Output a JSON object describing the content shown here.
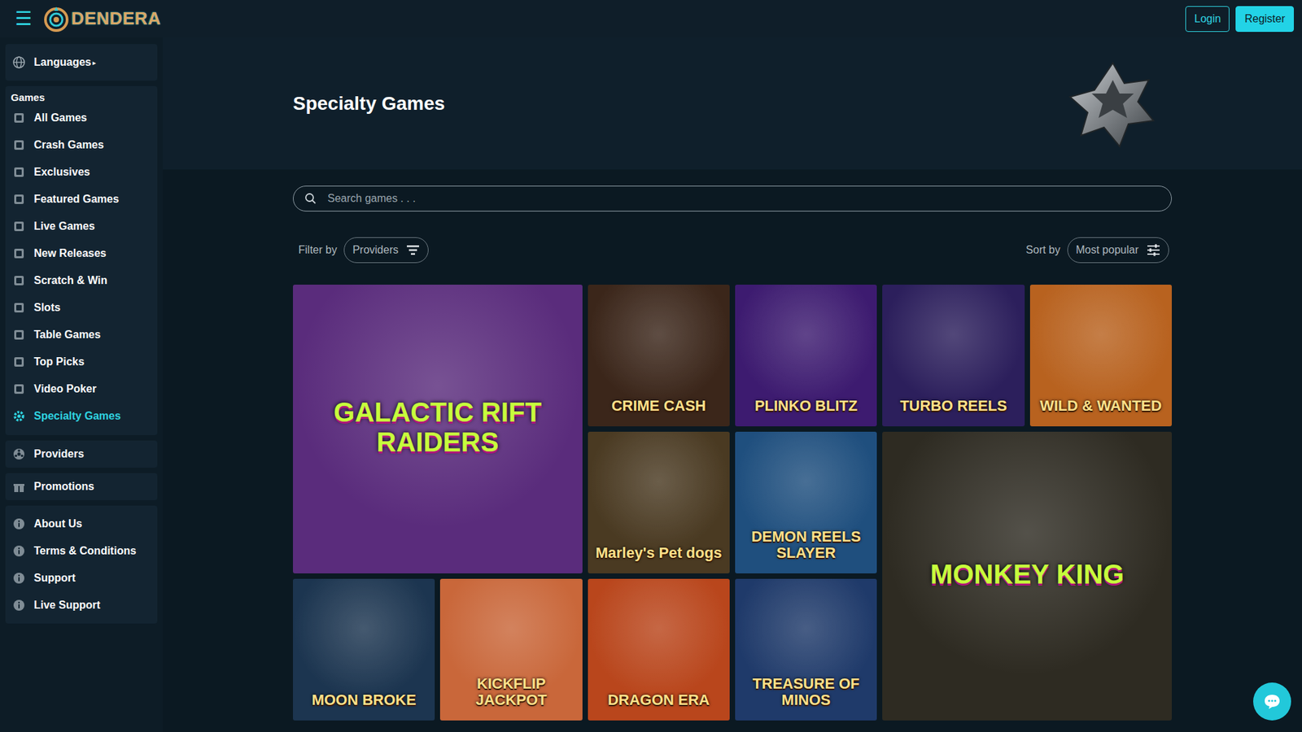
{
  "header": {
    "menu_icon": "☰",
    "logo": "DENDERA",
    "login": "Login",
    "register": "Register"
  },
  "sidebar": {
    "languages": {
      "label": "Languages",
      "caret": "▸"
    },
    "games_heading": "Games",
    "games": [
      {
        "label": "All Games",
        "selected": false
      },
      {
        "label": "Crash Games",
        "selected": false
      },
      {
        "label": "Exclusives",
        "selected": false
      },
      {
        "label": "Featured Games",
        "selected": false
      },
      {
        "label": "Live Games",
        "selected": false
      },
      {
        "label": "New Releases",
        "selected": false
      },
      {
        "label": "Scratch & Win",
        "selected": false
      },
      {
        "label": "Slots",
        "selected": false
      },
      {
        "label": "Table Games",
        "selected": false
      },
      {
        "label": "Top Picks",
        "selected": false
      },
      {
        "label": "Video Poker",
        "selected": false
      },
      {
        "label": "Specialty Games",
        "selected": true
      }
    ],
    "providers": "Providers",
    "promotions": "Promotions",
    "info": [
      "About Us",
      "Terms & Conditions",
      "Support",
      "Live Support"
    ]
  },
  "page": {
    "title": "Specialty Games"
  },
  "search": {
    "placeholder": "Search games . . ."
  },
  "filter": {
    "label": "Filter by",
    "value": "Providers"
  },
  "sort": {
    "label": "Sort by",
    "value": "Most popular"
  },
  "games": [
    {
      "title": "GALACTIC RIFT RAIDERS",
      "kind": "big",
      "color": "#5a2c7c"
    },
    {
      "title": "CRIME CASH",
      "kind": "small",
      "color": "#3b261a"
    },
    {
      "title": "PLINKO BLITZ",
      "kind": "small",
      "color": "#3d1b70"
    },
    {
      "title": "TURBO REELS",
      "kind": "small",
      "color": "#2c1f5c"
    },
    {
      "title": "WILD & WANTED",
      "kind": "small",
      "color": "#b8621f"
    },
    {
      "title": "Marley's Pet dogs",
      "kind": "small",
      "color": "#4a3a22"
    },
    {
      "title": "DEMON REELS SLAYER",
      "kind": "small",
      "color": "#1f4f7e"
    },
    {
      "title": "MONKEY KING",
      "kind": "big",
      "color": "#2e2b22"
    },
    {
      "title": "MOON BROKE",
      "kind": "small",
      "color": "#1c3550"
    },
    {
      "title": "KICKFLIP JACKPOT",
      "kind": "small",
      "color": "#c9673a"
    },
    {
      "title": "DRAGON ERA",
      "kind": "small",
      "color": "#b9461c"
    },
    {
      "title": "TREASURE OF MINOS",
      "kind": "small",
      "color": "#1f3a6a"
    }
  ]
}
